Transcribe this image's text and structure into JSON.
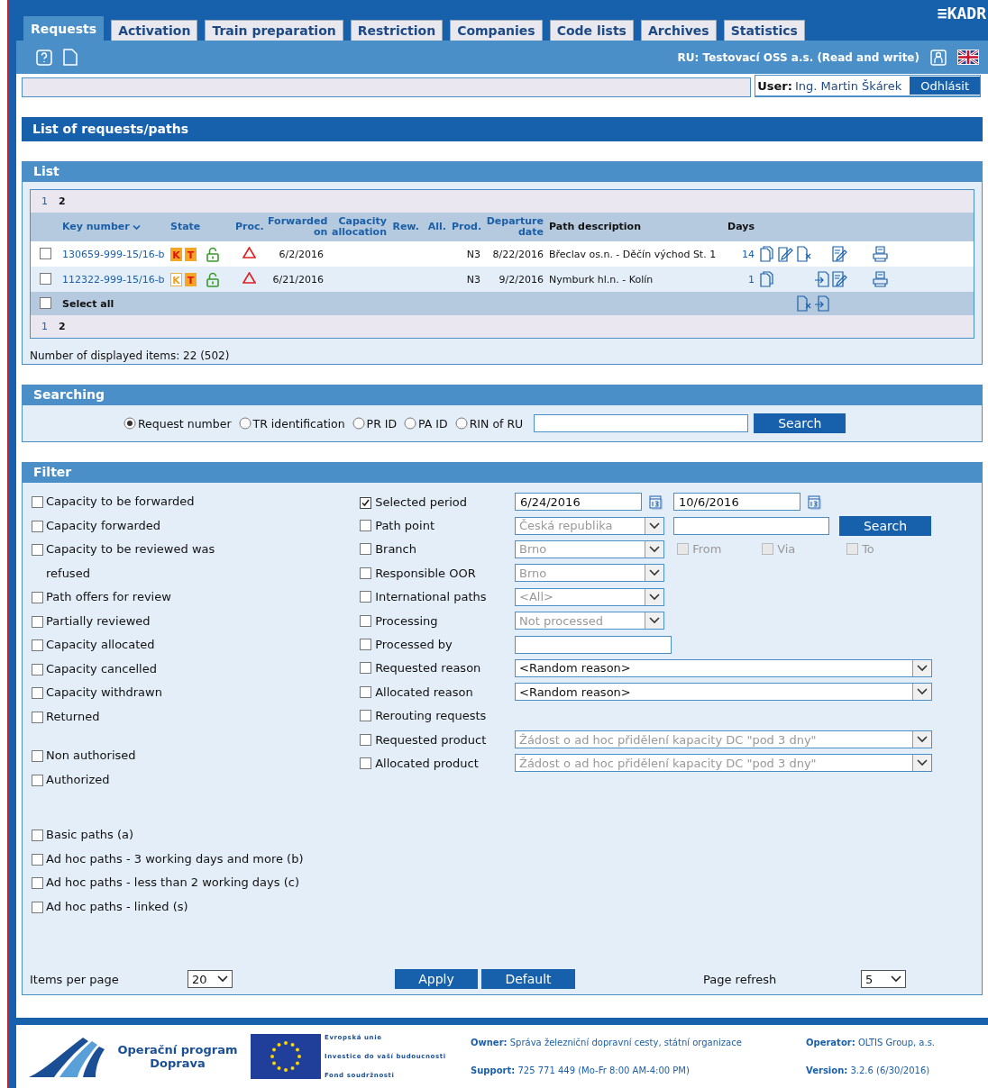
{
  "tabs": [
    {
      "label": "Requests",
      "selected": true
    },
    {
      "label": "Activation",
      "selected": false
    },
    {
      "label": "Train preparation",
      "selected": false
    },
    {
      "label": "Restriction",
      "selected": false
    },
    {
      "label": "Companies",
      "selected": false
    },
    {
      "label": "Code lists",
      "selected": false
    },
    {
      "label": "Archives",
      "selected": false
    },
    {
      "label": "Statistics",
      "selected": false
    }
  ],
  "logo": "≡KADR",
  "ru_label": "RU: Testovací OSS a.s. (Read and write)",
  "user": {
    "label": "User:",
    "name": "Ing. Martin Škárek",
    "logout": "Odhlásit"
  },
  "page_title": "List of requests/paths",
  "list": {
    "title": "List",
    "pages": [
      {
        "label": "1",
        "selected": false
      },
      {
        "label": "2",
        "selected": true
      }
    ],
    "columns": [
      {
        "label": "Key number",
        "sortable": true,
        "sorted": true
      },
      {
        "label": "State",
        "sortable": true,
        "sorted": false
      },
      {
        "label": "Proc.",
        "sortable": true,
        "sorted": false
      },
      {
        "label": "Forwarded on",
        "sortable": true,
        "sorted": false
      },
      {
        "label": "Capacity allocation",
        "sortable": true,
        "sorted": false
      },
      {
        "label": "Rew.",
        "sortable": true,
        "sorted": false
      },
      {
        "label": "All.",
        "sortable": true,
        "sorted": false
      },
      {
        "label": "Prod.",
        "sortable": true,
        "sorted": false
      },
      {
        "label": "Departure date",
        "sortable": true,
        "sorted": false
      },
      {
        "label": "Path description",
        "sortable": false,
        "sorted": false
      },
      {
        "label": "Days",
        "sortable": false,
        "sorted": false
      }
    ],
    "rows": [
      {
        "checked": false,
        "key": "130659-999-15/16-b",
        "badges": [
          {
            "letter": "K",
            "active": true
          },
          {
            "letter": "T",
            "active": true
          }
        ],
        "forwarded": "6/2/2016",
        "prod": "N3",
        "departure": "8/22/2016",
        "path": "Břeclav os.n. - Děčín východ St. 1",
        "days": "14",
        "actions": [
          {
            "kind": "copy"
          },
          {
            "kind": "edit"
          },
          {
            "kind": "cancel"
          },
          {
            "kind": "note"
          },
          {
            "kind": "print"
          }
        ]
      },
      {
        "checked": false,
        "key": "112322-999-15/16-b",
        "badges": [
          {
            "letter": "K",
            "active": false
          },
          {
            "letter": "T",
            "active": true
          }
        ],
        "forwarded": "6/21/2016",
        "prod": "N3",
        "departure": "9/2/2016",
        "path": "Nymburk hl.n. - Kolín",
        "days": "1",
        "actions": [
          {
            "kind": "copy"
          },
          {
            "kind": "import"
          },
          {
            "kind": "note"
          },
          {
            "kind": "print"
          }
        ]
      }
    ],
    "select_all": {
      "label": "Select all",
      "checked": false,
      "actions": [
        {
          "kind": "cancel"
        },
        {
          "kind": "import"
        }
      ]
    },
    "pages_bottom": [
      {
        "label": "1",
        "selected": false
      },
      {
        "label": "2",
        "selected": true
      }
    ],
    "count": "Number of displayed items: 22 (502)"
  },
  "searching": {
    "title": "Searching",
    "options": [
      {
        "label": "Request number",
        "selected": true
      },
      {
        "label": "TR identification",
        "selected": false
      },
      {
        "label": "PR ID",
        "selected": false
      },
      {
        "label": "PA ID",
        "selected": false
      },
      {
        "label": "RIN of RU",
        "selected": false
      }
    ],
    "button": "Search"
  },
  "filter": {
    "title": "Filter",
    "left_groups": [
      [
        {
          "label": "Capacity to be forwarded",
          "checked": false
        },
        {
          "label": "Capacity forwarded",
          "checked": false
        },
        {
          "label": "Capacity to be reviewed was refused",
          "checked": false
        },
        {
          "label": "Path offers for review",
          "checked": false
        },
        {
          "label": "Partially reviewed",
          "checked": false
        },
        {
          "label": "Capacity allocated",
          "checked": false
        },
        {
          "label": "Capacity cancelled",
          "checked": false
        },
        {
          "label": "Capacity withdrawn",
          "checked": false
        },
        {
          "label": "Returned",
          "checked": false
        }
      ],
      [
        {
          "label": "Non authorised",
          "checked": false
        },
        {
          "label": "Authorized",
          "checked": false
        }
      ],
      [
        {
          "label": "Basic paths (a)",
          "checked": false
        },
        {
          "label": "Ad hoc paths - 3 working days and more (b)",
          "checked": false
        },
        {
          "label": "Ad hoc paths - less than 2 working days (c)",
          "checked": false
        },
        {
          "label": "Ad hoc paths - linked (s)",
          "checked": false
        }
      ]
    ],
    "rows": [
      {
        "label": "Selected period",
        "checked": true,
        "kind": "period",
        "from": "6/24/2016",
        "to": "10/6/2016"
      },
      {
        "label": "Path point",
        "checked": false,
        "kind": "point",
        "value": "Česká republika",
        "disabled": true,
        "button": "Search"
      },
      {
        "label": "Branch",
        "checked": false,
        "kind": "branch",
        "value": "Brno",
        "disabled": true,
        "flags": [
          {
            "label": "From",
            "checked": false
          },
          {
            "label": "Via",
            "checked": false
          },
          {
            "label": "To",
            "checked": false
          }
        ]
      },
      {
        "label": "Responsible OOR",
        "checked": false,
        "kind": "select",
        "value": "Brno",
        "disabled": true
      },
      {
        "label": "International paths",
        "checked": false,
        "kind": "select",
        "value": "<All>",
        "disabled": true
      },
      {
        "label": "Processing",
        "checked": false,
        "kind": "select",
        "value": "Not processed",
        "disabled": true
      },
      {
        "label": "Processed by",
        "checked": false,
        "kind": "text"
      },
      {
        "label": "Requested reason",
        "checked": false,
        "kind": "wide",
        "value": "<Random reason>",
        "disabled": false
      },
      {
        "label": "Allocated reason",
        "checked": false,
        "kind": "wide",
        "value": "<Random reason>",
        "disabled": false
      },
      {
        "label": "Rerouting requests",
        "checked": false,
        "kind": "none"
      },
      {
        "label": "Requested product",
        "checked": false,
        "kind": "wide",
        "value": "Žádost o ad hoc přidělení kapacity DC \"pod 3 dny\"",
        "disabled": true
      },
      {
        "label": "Allocated product",
        "checked": false,
        "kind": "wide",
        "value": "Žádost o ad hoc přidělení kapacity DC \"pod 3 dny\"",
        "disabled": true
      }
    ],
    "items_label": "Items per page",
    "items_value": "20",
    "apply": "Apply",
    "default": "Default",
    "refresh_label": "Page refresh",
    "refresh_value": "5"
  },
  "footer": {
    "program": "Operační program Doprava",
    "eu": [
      "Evropská unie",
      "Investice do vaší budoucnosti",
      "Fond soudržnosti"
    ],
    "owner_label": "Owner:",
    "owner": "Správa železniční dopravní cesty, státní organizace",
    "support_label": "Support:",
    "support": "725 771 449 (Mo-Fr 8:00 AM-4:00 PM)",
    "operator_label": "Operator:",
    "operator": "OLTIS Group, a.s.",
    "version_label": "Version:",
    "version": "3.2.6 (6/30/2016)"
  }
}
